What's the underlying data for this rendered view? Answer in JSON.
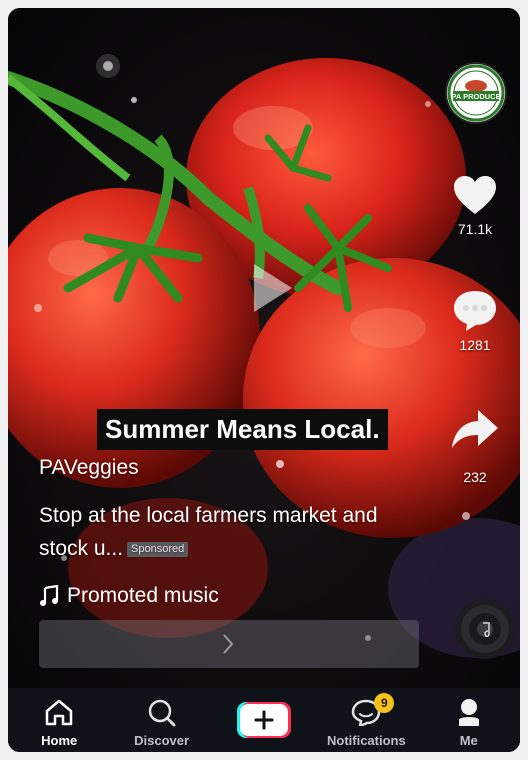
{
  "video": {
    "caption": "Summer Means Local.",
    "author": "PAVeggies",
    "description": "Stop at the local farmers market and stock u...",
    "sponsored_label": "Sponsored",
    "music": "Promoted music",
    "cta_icon": "chevron-right-icon"
  },
  "rail": {
    "avatar_text": "PA PRODUCE",
    "likes": "71.1k",
    "comments": "1281",
    "shares": "232"
  },
  "nav": {
    "items": [
      {
        "label": "Home",
        "icon": "home-icon",
        "active": true
      },
      {
        "label": "Discover",
        "icon": "search-icon",
        "active": false
      },
      {
        "label": "",
        "icon": "create-plus-icon",
        "active": false
      },
      {
        "label": "Notifications",
        "icon": "chat-bubble-icon",
        "badge": "9",
        "active": false
      },
      {
        "label": "Me",
        "icon": "profile-icon",
        "active": false
      }
    ]
  },
  "colors": {
    "tomato": "#e2281c",
    "stem": "#3d9a2a",
    "nav_bg": "#0f1219",
    "badge": "#f6c11a"
  }
}
